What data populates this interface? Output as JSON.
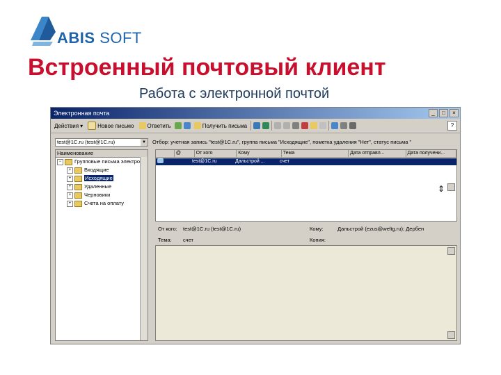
{
  "brand": {
    "logo_text_bold": "ABIS",
    "logo_text_light": "SOFT"
  },
  "slide": {
    "title": "Встроенный почтовый клиент",
    "subtitle": "Работа с электронной почтой"
  },
  "window": {
    "title": "Электронная почта",
    "controls": [
      "_",
      "□",
      "×"
    ],
    "toolbar": {
      "actions_label": "Действия",
      "new_message_label": "Новое письмо",
      "reply_label": "Ответить",
      "receive_label": "Получить письма",
      "help_label": "?"
    },
    "account": {
      "value": "test@1C.ru (test@1C.ru)"
    },
    "tree": {
      "header": "Наименование",
      "nodes": [
        {
          "label": "Групповые письма электро..."
        },
        {
          "label": "Входящие"
        },
        {
          "label": "Исходящие"
        },
        {
          "label": "Удаленные"
        },
        {
          "label": "Черновики"
        },
        {
          "label": "Счета на оплату"
        }
      ]
    },
    "filter_text": "Отбор: учетная запись \"test@1C.ru\", группа письма \"Исходящие\", пометка удаления \"Нет\", статус письма \"",
    "grid": {
      "columns": [
        "",
        "@",
        "От кого",
        "Кому",
        "Тема",
        "Дата отправл...",
        "Дата получени..."
      ],
      "rows": [
        {
          "from": "test@1C.ru",
          "to": "Дальстрой ...",
          "subject": "счет"
        }
      ]
    },
    "details": {
      "from_label": "От кого:",
      "from_value": "test@1C.ru (test@1C.ru)",
      "to_label": "Кому:",
      "to_value": "Дальстрой (ezus@weltg.ru); Дербен",
      "subject_label": "Тема:",
      "subject_value": "счет",
      "copy_label": "Копия:"
    }
  },
  "colors": {
    "title_red": "#c8102e",
    "brand_blue": "#1f63a8",
    "selection": "#0a246a"
  }
}
